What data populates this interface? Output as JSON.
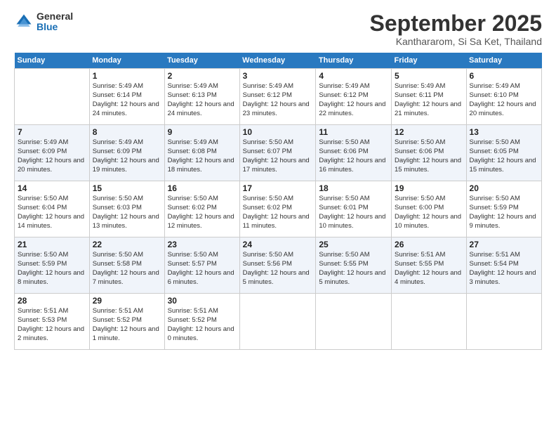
{
  "header": {
    "logo_general": "General",
    "logo_blue": "Blue",
    "month_title": "September 2025",
    "location": "Kanthararom, Si Sa Ket, Thailand"
  },
  "weekdays": [
    "Sunday",
    "Monday",
    "Tuesday",
    "Wednesday",
    "Thursday",
    "Friday",
    "Saturday"
  ],
  "weeks": [
    [
      {
        "day": "",
        "sunrise": "",
        "sunset": "",
        "daylight": ""
      },
      {
        "day": "1",
        "sunrise": "Sunrise: 5:49 AM",
        "sunset": "Sunset: 6:14 PM",
        "daylight": "Daylight: 12 hours and 24 minutes."
      },
      {
        "day": "2",
        "sunrise": "Sunrise: 5:49 AM",
        "sunset": "Sunset: 6:13 PM",
        "daylight": "Daylight: 12 hours and 24 minutes."
      },
      {
        "day": "3",
        "sunrise": "Sunrise: 5:49 AM",
        "sunset": "Sunset: 6:12 PM",
        "daylight": "Daylight: 12 hours and 23 minutes."
      },
      {
        "day": "4",
        "sunrise": "Sunrise: 5:49 AM",
        "sunset": "Sunset: 6:12 PM",
        "daylight": "Daylight: 12 hours and 22 minutes."
      },
      {
        "day": "5",
        "sunrise": "Sunrise: 5:49 AM",
        "sunset": "Sunset: 6:11 PM",
        "daylight": "Daylight: 12 hours and 21 minutes."
      },
      {
        "day": "6",
        "sunrise": "Sunrise: 5:49 AM",
        "sunset": "Sunset: 6:10 PM",
        "daylight": "Daylight: 12 hours and 20 minutes."
      }
    ],
    [
      {
        "day": "7",
        "sunrise": "Sunrise: 5:49 AM",
        "sunset": "Sunset: 6:09 PM",
        "daylight": "Daylight: 12 hours and 20 minutes."
      },
      {
        "day": "8",
        "sunrise": "Sunrise: 5:49 AM",
        "sunset": "Sunset: 6:09 PM",
        "daylight": "Daylight: 12 hours and 19 minutes."
      },
      {
        "day": "9",
        "sunrise": "Sunrise: 5:49 AM",
        "sunset": "Sunset: 6:08 PM",
        "daylight": "Daylight: 12 hours and 18 minutes."
      },
      {
        "day": "10",
        "sunrise": "Sunrise: 5:50 AM",
        "sunset": "Sunset: 6:07 PM",
        "daylight": "Daylight: 12 hours and 17 minutes."
      },
      {
        "day": "11",
        "sunrise": "Sunrise: 5:50 AM",
        "sunset": "Sunset: 6:06 PM",
        "daylight": "Daylight: 12 hours and 16 minutes."
      },
      {
        "day": "12",
        "sunrise": "Sunrise: 5:50 AM",
        "sunset": "Sunset: 6:06 PM",
        "daylight": "Daylight: 12 hours and 15 minutes."
      },
      {
        "day": "13",
        "sunrise": "Sunrise: 5:50 AM",
        "sunset": "Sunset: 6:05 PM",
        "daylight": "Daylight: 12 hours and 15 minutes."
      }
    ],
    [
      {
        "day": "14",
        "sunrise": "Sunrise: 5:50 AM",
        "sunset": "Sunset: 6:04 PM",
        "daylight": "Daylight: 12 hours and 14 minutes."
      },
      {
        "day": "15",
        "sunrise": "Sunrise: 5:50 AM",
        "sunset": "Sunset: 6:03 PM",
        "daylight": "Daylight: 12 hours and 13 minutes."
      },
      {
        "day": "16",
        "sunrise": "Sunrise: 5:50 AM",
        "sunset": "Sunset: 6:02 PM",
        "daylight": "Daylight: 12 hours and 12 minutes."
      },
      {
        "day": "17",
        "sunrise": "Sunrise: 5:50 AM",
        "sunset": "Sunset: 6:02 PM",
        "daylight": "Daylight: 12 hours and 11 minutes."
      },
      {
        "day": "18",
        "sunrise": "Sunrise: 5:50 AM",
        "sunset": "Sunset: 6:01 PM",
        "daylight": "Daylight: 12 hours and 10 minutes."
      },
      {
        "day": "19",
        "sunrise": "Sunrise: 5:50 AM",
        "sunset": "Sunset: 6:00 PM",
        "daylight": "Daylight: 12 hours and 10 minutes."
      },
      {
        "day": "20",
        "sunrise": "Sunrise: 5:50 AM",
        "sunset": "Sunset: 5:59 PM",
        "daylight": "Daylight: 12 hours and 9 minutes."
      }
    ],
    [
      {
        "day": "21",
        "sunrise": "Sunrise: 5:50 AM",
        "sunset": "Sunset: 5:59 PM",
        "daylight": "Daylight: 12 hours and 8 minutes."
      },
      {
        "day": "22",
        "sunrise": "Sunrise: 5:50 AM",
        "sunset": "Sunset: 5:58 PM",
        "daylight": "Daylight: 12 hours and 7 minutes."
      },
      {
        "day": "23",
        "sunrise": "Sunrise: 5:50 AM",
        "sunset": "Sunset: 5:57 PM",
        "daylight": "Daylight: 12 hours and 6 minutes."
      },
      {
        "day": "24",
        "sunrise": "Sunrise: 5:50 AM",
        "sunset": "Sunset: 5:56 PM",
        "daylight": "Daylight: 12 hours and 5 minutes."
      },
      {
        "day": "25",
        "sunrise": "Sunrise: 5:50 AM",
        "sunset": "Sunset: 5:55 PM",
        "daylight": "Daylight: 12 hours and 5 minutes."
      },
      {
        "day": "26",
        "sunrise": "Sunrise: 5:51 AM",
        "sunset": "Sunset: 5:55 PM",
        "daylight": "Daylight: 12 hours and 4 minutes."
      },
      {
        "day": "27",
        "sunrise": "Sunrise: 5:51 AM",
        "sunset": "Sunset: 5:54 PM",
        "daylight": "Daylight: 12 hours and 3 minutes."
      }
    ],
    [
      {
        "day": "28",
        "sunrise": "Sunrise: 5:51 AM",
        "sunset": "Sunset: 5:53 PM",
        "daylight": "Daylight: 12 hours and 2 minutes."
      },
      {
        "day": "29",
        "sunrise": "Sunrise: 5:51 AM",
        "sunset": "Sunset: 5:52 PM",
        "daylight": "Daylight: 12 hours and 1 minute."
      },
      {
        "day": "30",
        "sunrise": "Sunrise: 5:51 AM",
        "sunset": "Sunset: 5:52 PM",
        "daylight": "Daylight: 12 hours and 0 minutes."
      },
      {
        "day": "",
        "sunrise": "",
        "sunset": "",
        "daylight": ""
      },
      {
        "day": "",
        "sunrise": "",
        "sunset": "",
        "daylight": ""
      },
      {
        "day": "",
        "sunrise": "",
        "sunset": "",
        "daylight": ""
      },
      {
        "day": "",
        "sunrise": "",
        "sunset": "",
        "daylight": ""
      }
    ]
  ]
}
